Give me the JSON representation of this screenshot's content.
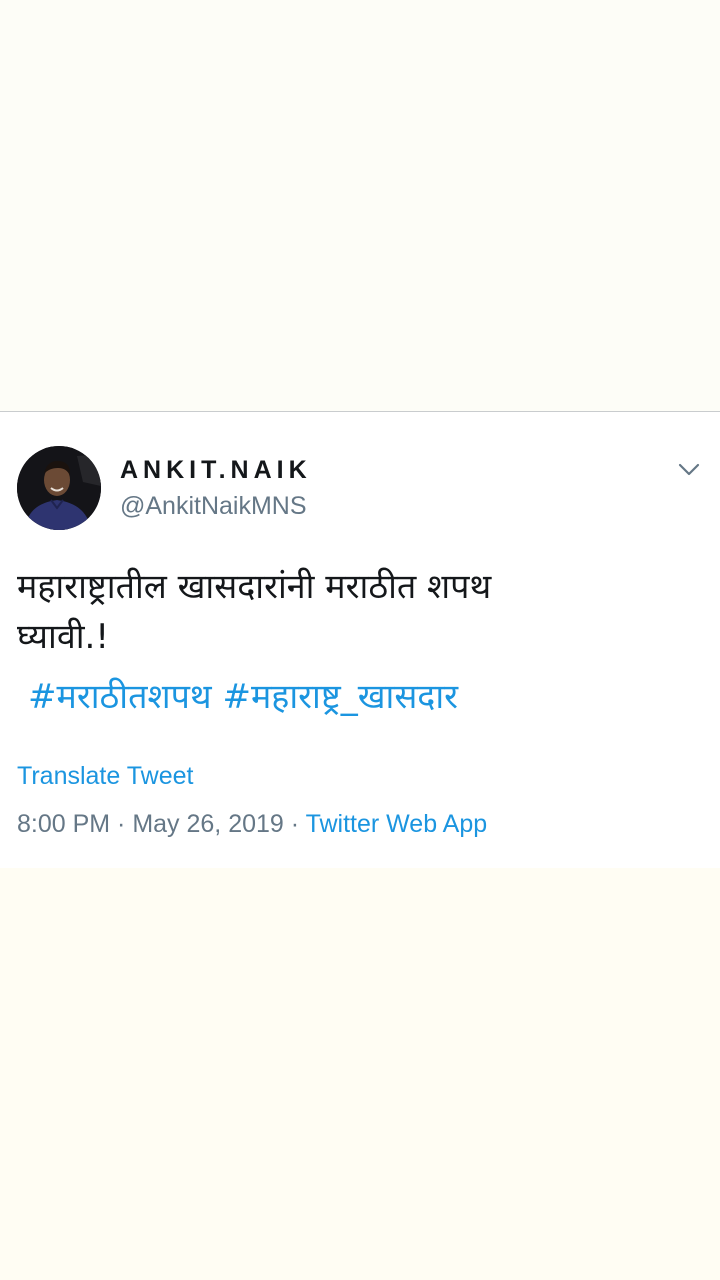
{
  "tweet": {
    "display_name": "ANKIT.NAIK",
    "handle": "@AnkitNaikMNS",
    "text_line_1": "महाराष्ट्रातील खासदारांनी मराठीत शपथ",
    "text_line_2": "घ्यावी.!",
    "hashtag_1": "#मराठीतशपथ",
    "hashtag_2": "#महाराष्ट्र_खासदार",
    "translate_label": "Translate Tweet",
    "time": "8:00 PM",
    "separator": " · ",
    "date": "May 26, 2019",
    "source": "Twitter Web App"
  },
  "icons": {
    "menu": "chevron-down-icon",
    "avatar": "avatar"
  },
  "colors": {
    "link": "#1b95e0",
    "text": "#14171a",
    "muted": "#657786",
    "background": "#fffdf3"
  }
}
